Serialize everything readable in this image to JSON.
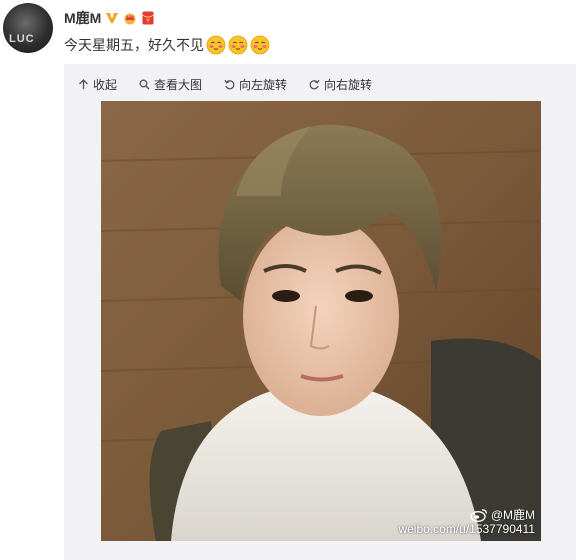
{
  "post": {
    "username": "M鹿M",
    "avatar_text": "LUC",
    "text": "今天星期五，好久不见",
    "emoji_count": 3
  },
  "toolbar": {
    "collapse_label": "收起",
    "view_large_label": "查看大图",
    "rotate_left_label": "向左旋转",
    "rotate_right_label": "向右旋转"
  },
  "watermark": {
    "handle": "@M鹿M",
    "url": "weibo.com/u/1537790411"
  },
  "colors": {
    "text": "#333333",
    "media_bg": "#f2f2f5",
    "verified_gold": "#f5a623",
    "hongbao_red": "#e4393c"
  },
  "icons": [
    "verified-v-icon",
    "crown-badge-icon",
    "hongbao-icon",
    "blush-emoji-icon",
    "arrow-up-icon",
    "magnifier-icon",
    "rotate-left-icon",
    "rotate-right-icon",
    "weibo-logo-icon"
  ]
}
